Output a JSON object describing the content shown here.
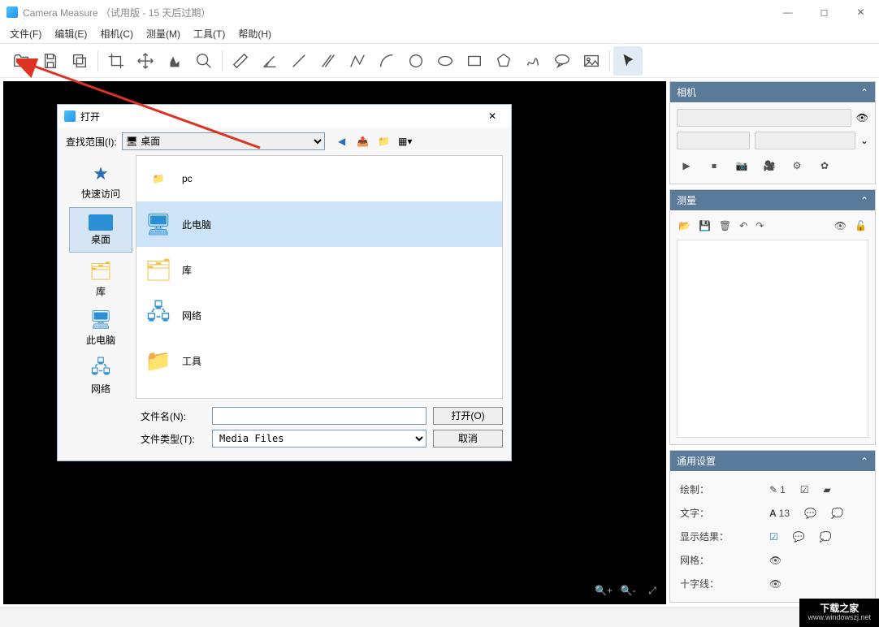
{
  "window": {
    "title": "Camera Measure （试用版 - 15 天后过期）"
  },
  "menu": {
    "items": [
      "文件(F)",
      "编辑(E)",
      "相机(C)",
      "测量(M)",
      "工具(T)",
      "帮助(H)"
    ]
  },
  "toolbar_names": [
    "open",
    "save",
    "copy",
    "crop",
    "move",
    "histogram",
    "zoom",
    "ruler",
    "angle",
    "line",
    "parallel",
    "polyline",
    "arc",
    "circle",
    "ellipse",
    "rect",
    "polygon",
    "freeform",
    "comment",
    "image",
    "pointer"
  ],
  "side": {
    "camera": {
      "title": "相机"
    },
    "measure": {
      "title": "测量"
    },
    "general": {
      "title": "通用设置",
      "rows": {
        "draw": {
          "label": "绘制：",
          "pen_sub": "1"
        },
        "text": {
          "label": "文字：",
          "font_sub": "13"
        },
        "result": {
          "label": "显示结果："
        },
        "grid": {
          "label": "网格："
        },
        "cross": {
          "label": "十字线："
        }
      }
    }
  },
  "dialog": {
    "title": "打开",
    "lookin_label": "查找范围(I):",
    "lookin_value": "桌面",
    "places": [
      {
        "key": "quick",
        "label": "快速访问"
      },
      {
        "key": "desktop",
        "label": "桌面"
      },
      {
        "key": "library",
        "label": "库"
      },
      {
        "key": "thispc",
        "label": "此电脑"
      },
      {
        "key": "network",
        "label": "网络"
      }
    ],
    "files": [
      {
        "key": "pc",
        "label": "pc"
      },
      {
        "key": "thispc",
        "label": "此电脑"
      },
      {
        "key": "library",
        "label": "库"
      },
      {
        "key": "network",
        "label": "网络"
      },
      {
        "key": "tools",
        "label": "工具"
      }
    ],
    "filename_label": "文件名(N):",
    "filename_value": "",
    "filetype_label": "文件类型(T):",
    "filetype_value": "Media Files",
    "open_btn": "打开(O)",
    "cancel_btn": "取消"
  },
  "watermark": {
    "main": "下载之家",
    "sub": "www.windowszj.net"
  }
}
